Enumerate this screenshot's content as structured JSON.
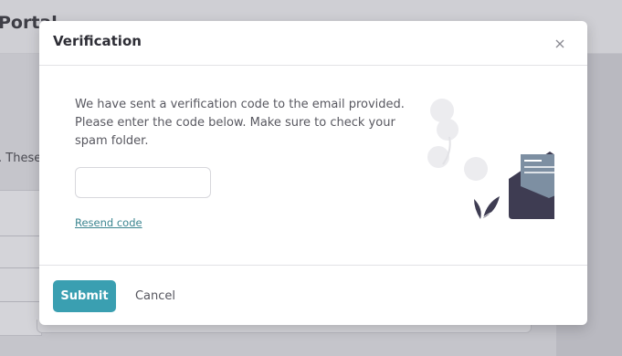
{
  "background": {
    "header_title": "Portal",
    "partial_text": ". These"
  },
  "modal": {
    "title": "Verification",
    "close_icon": "close-icon",
    "message": "We have sent a verification code to the email provided. Please enter the code below. Make sure to check your spam folder.",
    "code_input": {
      "value": "",
      "placeholder": ""
    },
    "resend_label": "Resend code",
    "illustration": "envelope-check-illustration",
    "submit_label": "Submit",
    "cancel_label": "Cancel"
  },
  "colors": {
    "primary": "#3a9fb1",
    "link": "#3b8590",
    "envelope": "#3e3c52",
    "check": "#4caf72"
  }
}
